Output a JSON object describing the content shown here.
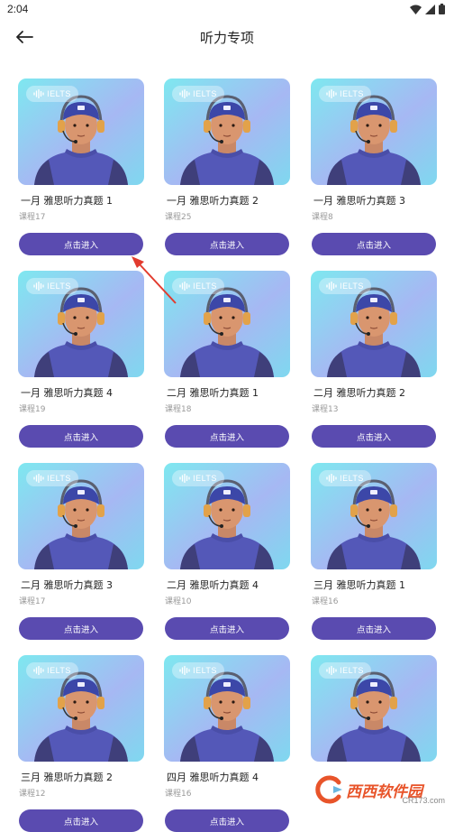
{
  "status_bar": {
    "time": "2:04",
    "icons": [
      "wifi-icon",
      "cellular-signal-icon",
      "battery-icon"
    ]
  },
  "header": {
    "title": "听力专项",
    "back_icon": "arrow-left-icon"
  },
  "badge_label": "IELTS",
  "enter_label": "点击进入",
  "courses": [
    {
      "title": "一月 雅思听力真题 1",
      "count": "课程17"
    },
    {
      "title": "一月 雅思听力真题 2",
      "count": "课程25"
    },
    {
      "title": "一月 雅思听力真题 3",
      "count": "课程8"
    },
    {
      "title": "一月 雅思听力真题 4",
      "count": "课程19"
    },
    {
      "title": "二月 雅思听力真题 1",
      "count": "课程18"
    },
    {
      "title": "二月 雅思听力真题 2",
      "count": "课程13"
    },
    {
      "title": "二月 雅思听力真题 3",
      "count": "课程17"
    },
    {
      "title": "二月 雅思听力真题 4",
      "count": "课程10"
    },
    {
      "title": "三月 雅思听力真题 1",
      "count": "课程16"
    },
    {
      "title": "三月 雅思听力真题 2",
      "count": "课程12"
    },
    {
      "title": "四月 雅思听力真题 4",
      "count": "课程16"
    },
    {
      "title": "",
      "count": ""
    }
  ],
  "colors": {
    "button": "#5a4bb0",
    "annotation_arrow": "#e23b2e",
    "watermark": "#e8542a"
  },
  "watermark": {
    "text": "西西软件园",
    "sub": "CR173.com"
  }
}
